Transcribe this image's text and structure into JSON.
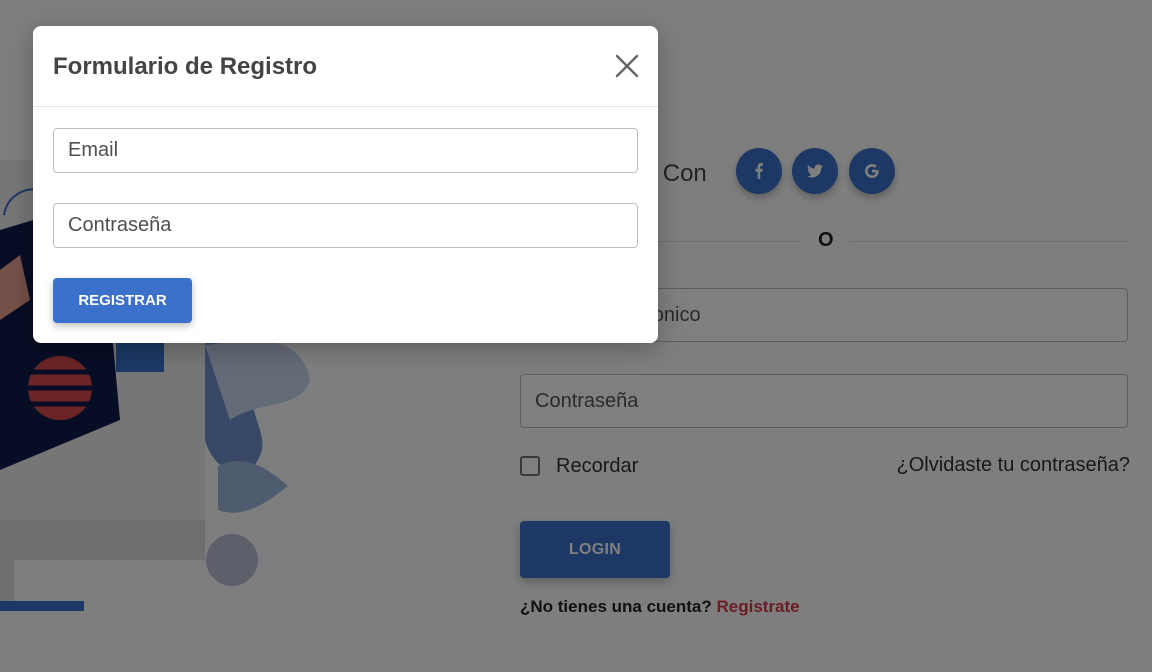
{
  "login": {
    "social_label": "Inicia Sesión Con",
    "social_buttons": [
      "f",
      "t",
      "G"
    ],
    "divider_text": "O",
    "email_placeholder": "Correo Electronico",
    "password_placeholder": "Contraseña",
    "remember_label": "Recordar",
    "forgot_link": "¿Olvidaste tu contraseña?",
    "login_button": "LOGIN",
    "signup_prompt": "¿No tienes una cuenta?",
    "signup_link": "Registrate"
  },
  "modal": {
    "title": "Formulario de Registro",
    "email_placeholder": "Email",
    "password_placeholder": "Contraseña",
    "register_button": "REGISTRAR"
  },
  "icons": {
    "social": [
      "facebook-icon",
      "twitter-icon",
      "google-icon"
    ],
    "close": "close-icon"
  },
  "colors": {
    "primary": "#3b71ca",
    "link": "#d63a4a",
    "overlay": "rgba(0,0,0,0.5)"
  }
}
